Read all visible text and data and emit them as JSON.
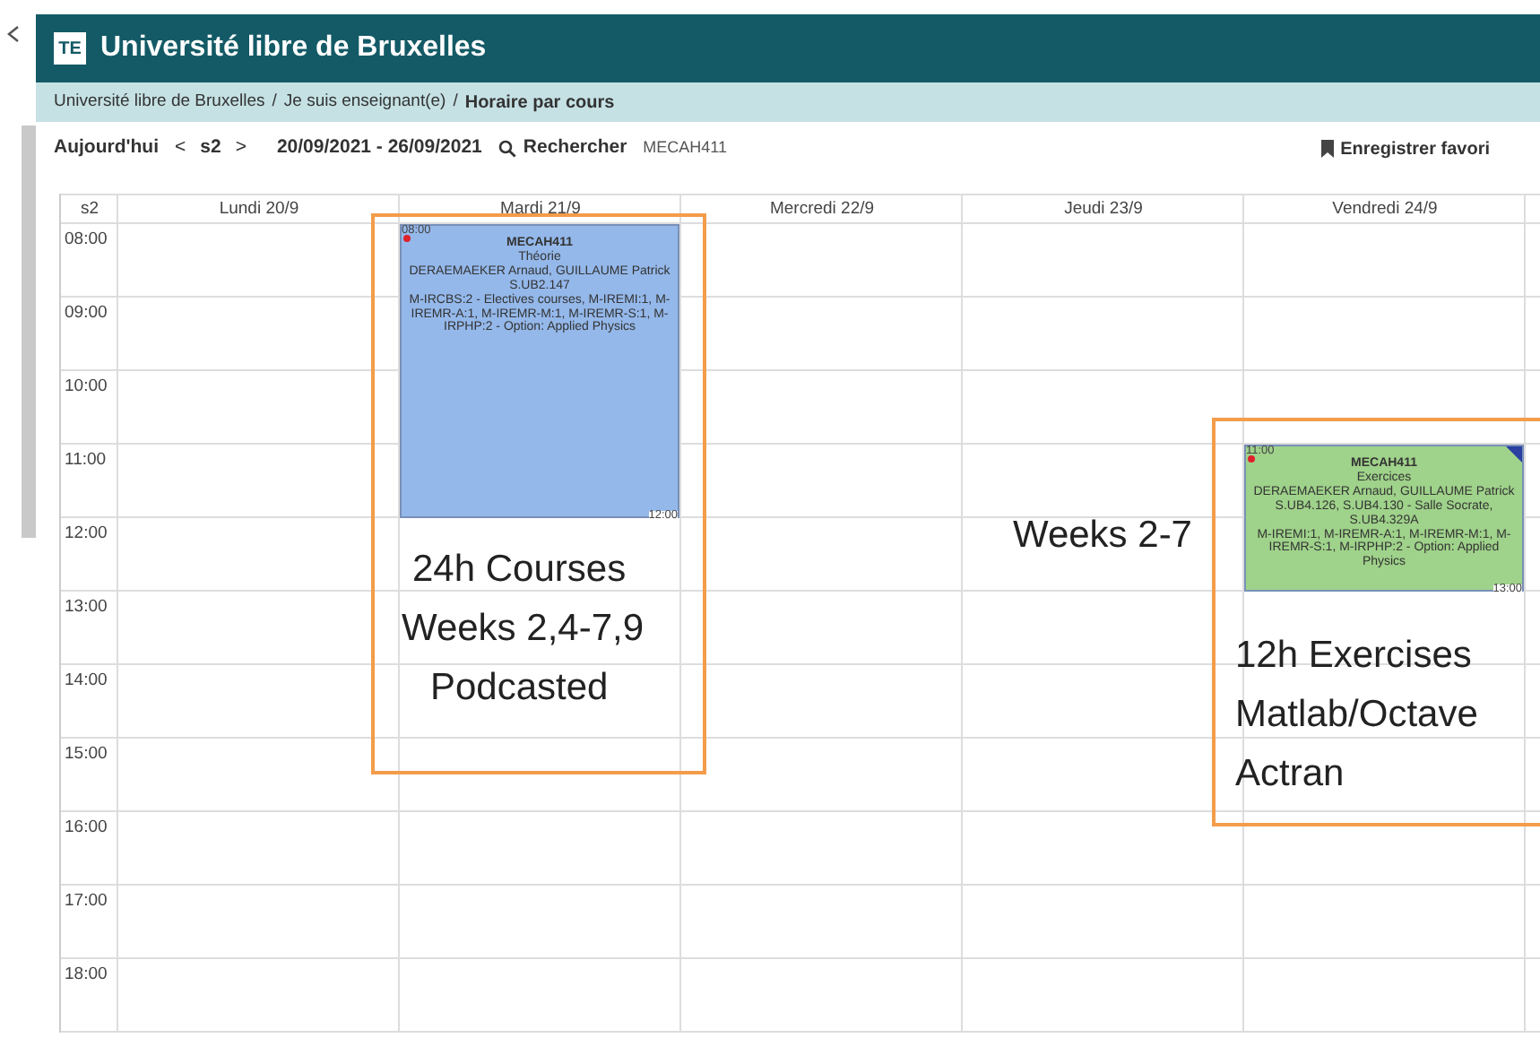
{
  "header": {
    "logo": "TE",
    "title": "Université libre de Bruxelles"
  },
  "breadcrumb": [
    {
      "label": "Université libre de Bruxelles",
      "current": false
    },
    {
      "separator": "/",
      "label": "Je suis enseignant(e)",
      "current": false
    },
    {
      "separator": "/",
      "label": "Horaire par cours",
      "current": true
    }
  ],
  "toolbar": {
    "today": "Aujourd'hui",
    "prev": "<",
    "week": "s2",
    "next": ">",
    "range": "20/09/2021 - 26/09/2021",
    "search": "Rechercher",
    "query": "MECAH411",
    "favorite": "Enregistrer favori"
  },
  "calendar": {
    "week_label": "s2",
    "hours": [
      "08:00",
      "09:00",
      "10:00",
      "11:00",
      "12:00",
      "13:00",
      "14:00",
      "15:00",
      "16:00",
      "17:00",
      "18:00"
    ],
    "days": [
      {
        "label": "Lundi 20/9"
      },
      {
        "label": "Mardi 21/9",
        "events": [
          {
            "start": "08:00",
            "end": "12:00",
            "code": "MECAH411",
            "flagged": false,
            "color": "#94b8ea",
            "lines": [
              "Théorie",
              "DERAEMAEKER Arnaud, GUILLAUME Patrick",
              "S.UB2.147",
              "M-IRCBS:2 - Electives courses, M-IREMI:1, M-IREMR-A:1, M-IREMR-M:1, M-IREMR-S:1, M-IRPHP:2 - Option: Applied Physics"
            ]
          }
        ]
      },
      {
        "label": "Mercredi 22/9"
      },
      {
        "label": "Jeudi 23/9"
      },
      {
        "label": "Vendredi 24/9",
        "events": [
          {
            "start": "11:00",
            "end": "13:00",
            "code": "MECAH411",
            "flagged": true,
            "color": "#9fd28a",
            "lines": [
              "Exercices",
              "DERAEMAEKER Arnaud, GUILLAUME Patrick",
              "S.UB4.126, S.UB4.130 - Salle Socrate, S.UB4.329A",
              "M-IREMI:1, M-IREMR-A:1, M-IREMR-M:1, M-IREMR-S:1, M-IRPHP:2 - Option: Applied Physics"
            ]
          }
        ]
      }
    ]
  },
  "annotations": [
    {
      "kind": "box",
      "lines": [
        "24h Courses",
        "Weeks 2,4-7,9",
        "Podcasted"
      ]
    },
    {
      "kind": "label",
      "lines": [
        "Weeks 2-7"
      ]
    },
    {
      "kind": "box",
      "lines": [
        "12h Exercises",
        "Matlab/Octave",
        "Actran"
      ]
    }
  ]
}
